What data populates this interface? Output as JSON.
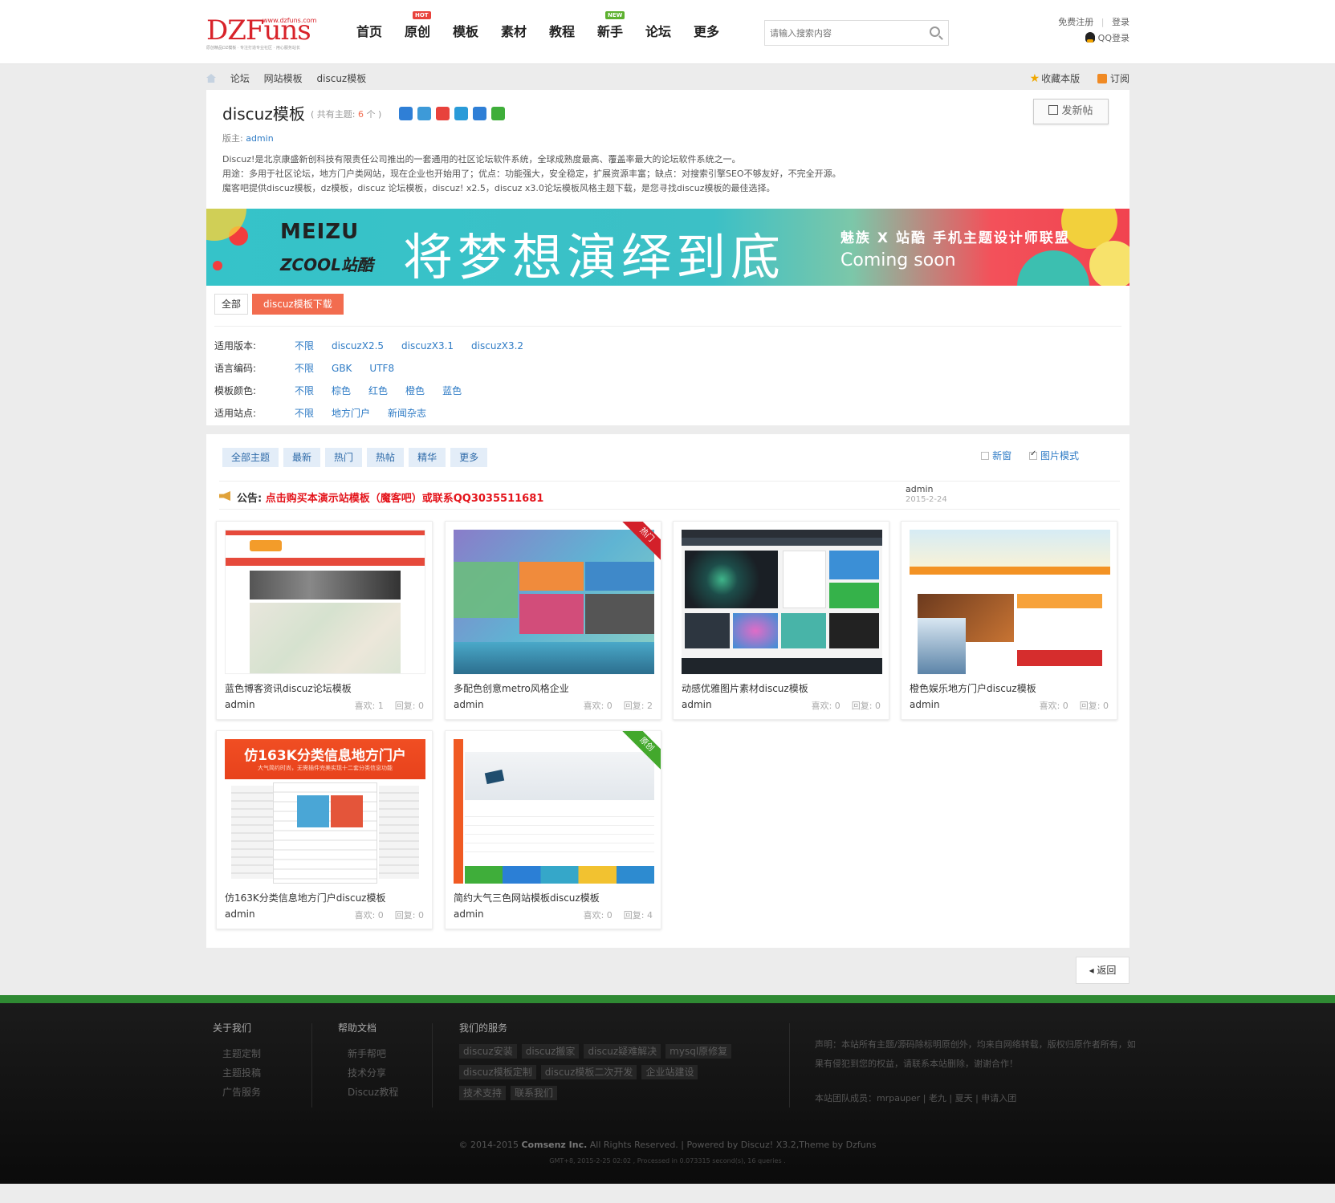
{
  "header": {
    "logo_text": "DZFuns",
    "logo_domain": "www.dzfuns.com",
    "logo_tagline": "原创精品DZ模板 · 专注打造专业社区 · 用心服务站长",
    "nav": [
      {
        "label": "首页",
        "badge": ""
      },
      {
        "label": "原创",
        "badge": "HOT",
        "badge_color": "#e8423c"
      },
      {
        "label": "模板",
        "badge": ""
      },
      {
        "label": "素材",
        "badge": ""
      },
      {
        "label": "教程",
        "badge": ""
      },
      {
        "label": "新手",
        "badge": "NEW",
        "badge_color": "#5db12f"
      },
      {
        "label": "论坛",
        "badge": ""
      },
      {
        "label": "更多",
        "badge": ""
      }
    ],
    "search_placeholder": "请输入搜索内容",
    "register": "免费注册",
    "login": "登录",
    "qq_login": "QQ登录"
  },
  "breadcrumb": {
    "items": [
      "论坛",
      "网站模板",
      "discuz模板"
    ],
    "favorite": "收藏本版",
    "subscribe": "订阅"
  },
  "forum": {
    "title": "discuz模板",
    "count_prefix": "( 共有主题: ",
    "count": "6",
    "count_suffix": " 个 )",
    "new_post": "发新帖",
    "moderator_label": "版主: ",
    "moderator": "admin",
    "desc": [
      "Discuz!是北京康盛新创科技有限责任公司推出的一套通用的社区论坛软件系统，全球成熟度最高、覆盖率最大的论坛软件系统之一。",
      "用途：多用于社区论坛，地方门户类网站，现在企业也开始用了；优点：功能强大，安全稳定，扩展资源丰富；缺点：对搜索引擎SEO不够友好，不完全开源。",
      "魔客吧提供discuz模板，dz模板，discuz 论坛模板，discuz! x2.5，discuz x3.0论坛模板风格主题下载，是您寻找discuz模板的最佳选择。"
    ],
    "share_colors": [
      "#2f7fd6",
      "#3d9ad8",
      "#e8423c",
      "#2a9bd8",
      "#2f7fd6",
      "#3fae3a"
    ]
  },
  "banner": {
    "brand1": "MEIZU",
    "brand2": "ZCOOL站酷",
    "slogan": "将梦想演绎到底",
    "right1": "魅族 X 站酷   手机主题设计师联盟",
    "right2": "Coming soon"
  },
  "type_tabs": [
    "全部",
    "discuz模板下载"
  ],
  "filters": [
    {
      "label": "适用版本:",
      "values": [
        "不限",
        "discuzX2.5",
        "discuzX3.1",
        "discuzX3.2"
      ]
    },
    {
      "label": "语言编码:",
      "values": [
        "不限",
        "GBK",
        "UTF8"
      ]
    },
    {
      "label": "模板颜色:",
      "values": [
        "不限",
        "棕色",
        "红色",
        "橙色",
        "蓝色"
      ]
    },
    {
      "label": "适用站点:",
      "values": [
        "不限",
        "地方门户",
        "新闻杂志"
      ]
    }
  ],
  "thread_tabs": [
    "全部主题",
    "最新",
    "热门",
    "热帖",
    "精华",
    "更多"
  ],
  "thread_options": {
    "new_window": "新窗",
    "image_mode": "图片模式"
  },
  "notice": {
    "prefix": "公告: ",
    "text": "点击购买本演示站模板（魔客吧）或联系QQ3035511681",
    "author": "admin",
    "date": "2015-2-24"
  },
  "cards": [
    {
      "title": "蓝色博客资讯discuz论坛模板",
      "author": "admin",
      "likes": "喜欢: 1",
      "replies": "回复: 0",
      "ribbon": ""
    },
    {
      "title": "多配色创意metro风格企业",
      "author": "admin",
      "likes": "喜欢: 0",
      "replies": "回复: 2",
      "ribbon": "热门",
      "ribbon_color": "#d3202a"
    },
    {
      "title": "动感优雅图片素材discuz模板",
      "author": "admin",
      "likes": "喜欢: 0",
      "replies": "回复: 0",
      "ribbon": ""
    },
    {
      "title": "橙色娱乐地方门户discuz模板",
      "author": "admin",
      "likes": "喜欢: 0",
      "replies": "回复: 0",
      "ribbon": ""
    },
    {
      "title": "仿163K分类信息地方门户discuz模板",
      "author": "admin",
      "likes": "喜欢: 0",
      "replies": "回复: 0",
      "ribbon": ""
    },
    {
      "title": "简约大气三色网站模板discuz模板",
      "author": "admin",
      "likes": "喜欢: 0",
      "replies": "回复: 4",
      "ribbon": "原创",
      "ribbon_color": "#43a82c"
    }
  ],
  "thumb5": {
    "headline": "仿163K分类信息地方门户",
    "sub": "大气简约时尚，无需插件完美实现十二套分类信息功能"
  },
  "back": "返回",
  "footer": {
    "about_title": "关于我们",
    "about_links": [
      "主题定制",
      "主题投稿",
      "广告服务"
    ],
    "help_title": "帮助文档",
    "help_links": [
      "新手帮吧",
      "技术分享",
      "Discuz教程"
    ],
    "service_title": "我们的服务",
    "service_links": [
      "discuz安装",
      "discuz搬家",
      "discuz疑难解决",
      "mysql原修复",
      "discuz模板定制",
      "discuz模板二次开发",
      "企业站建设",
      "技术支持",
      "联系我们"
    ],
    "note": "声明：本站所有主题/源码除标明原创外，均来自网络转载，版权归原作者所有，如果有侵犯到您的权益，请联系本站删除，谢谢合作！",
    "team": "本站团队成员：mrpauper | 老九 | 夏天 | 申请入团",
    "copyright_pre": "© 2014-2015 ",
    "copyright_company": "Comsenz Inc.",
    "copyright_post": " All Rights Reserved. | Powered by Discuz! X3.2,Theme by Dzfuns",
    "gmt": "GMT+8, 2015-2-25 02:02 , Processed in 0.073315 second(s), 16 queries ."
  }
}
